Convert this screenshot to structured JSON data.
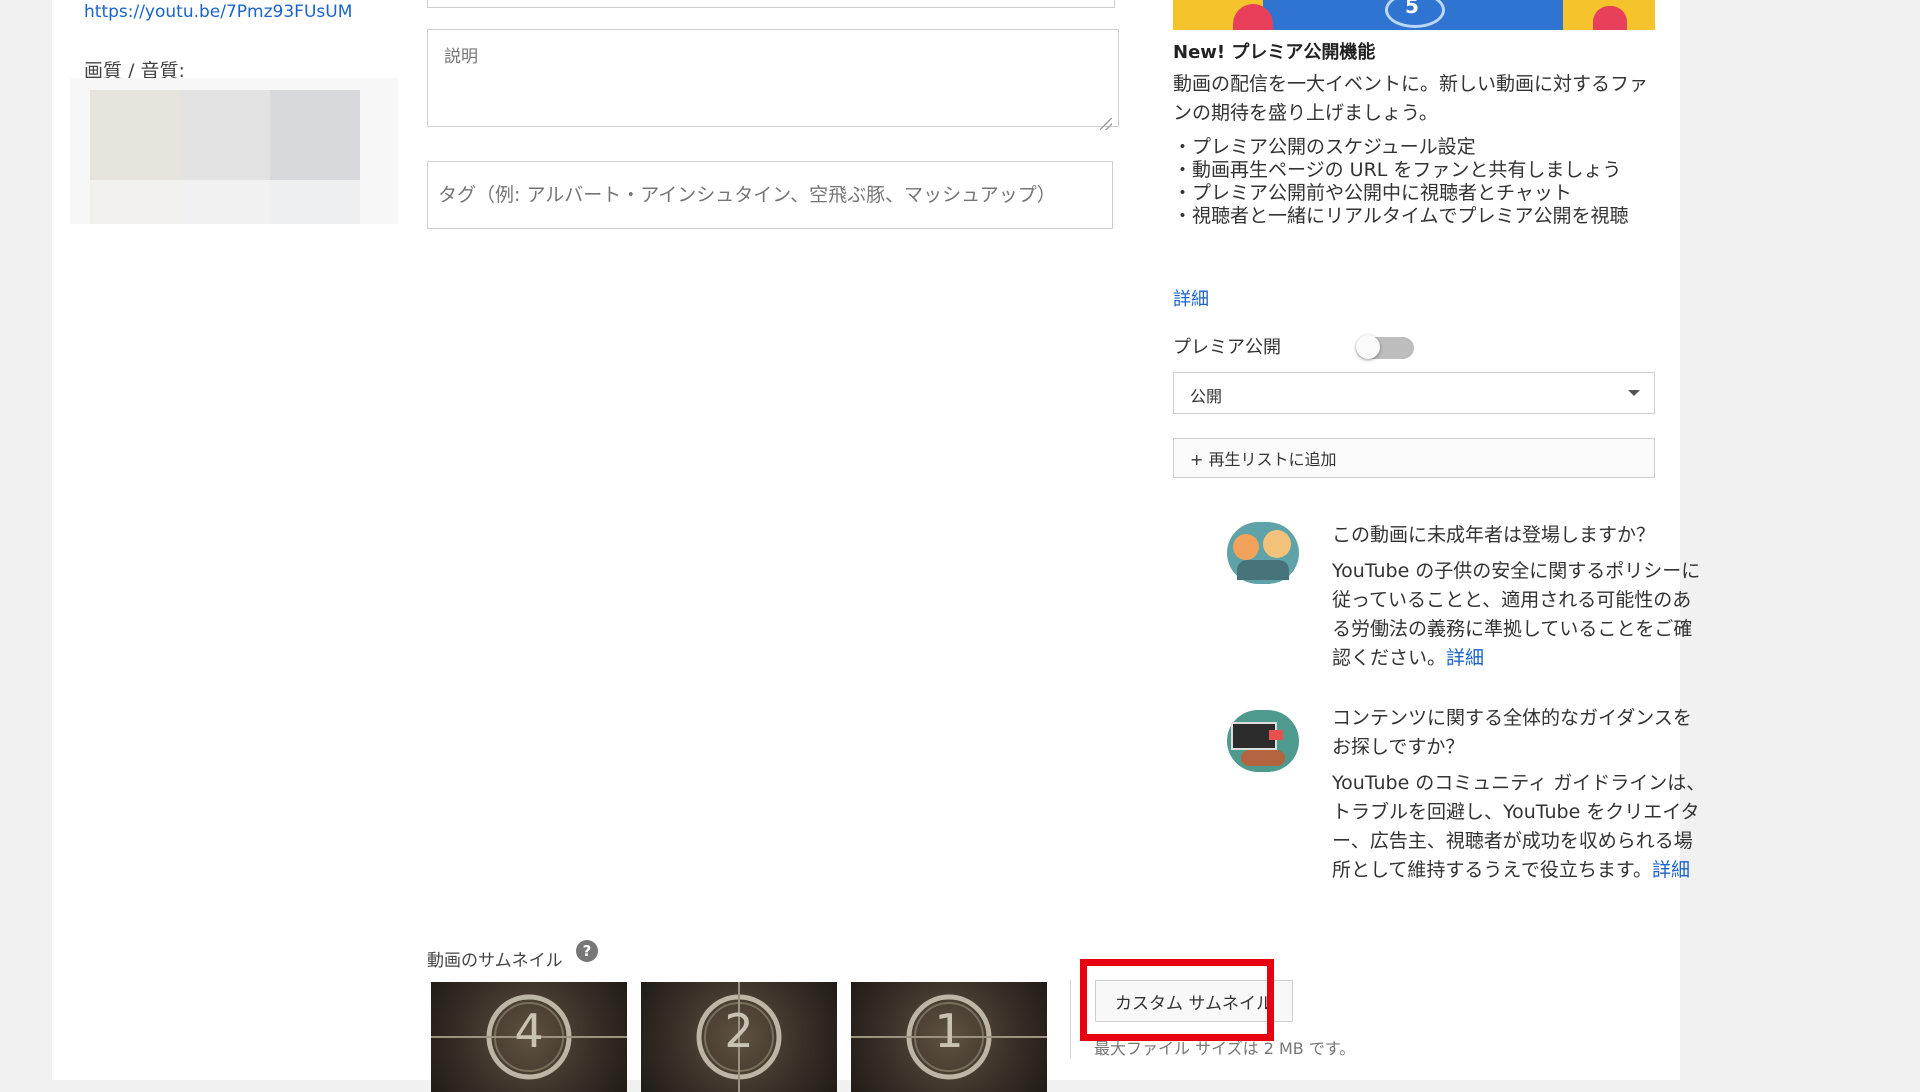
{
  "left": {
    "video_url": "https://youtu.be/7Pmz93FUsUM",
    "quality_label": "画質 / 音質:"
  },
  "form": {
    "description_placeholder": "説明",
    "tags_placeholder": "タグ（例: アルバート・アインシュタイン、空飛ぶ豚、マッシュアップ）"
  },
  "thumbnails": {
    "section_label": "動画のサムネイル",
    "help_icon": "?",
    "items": [
      "4",
      "2",
      "1"
    ],
    "custom_button": "カスタム サムネイル",
    "file_size_note": "最大ファイル サイズは 2 MB です。",
    "highlight_color": "#e60012"
  },
  "premiere": {
    "banner_text": "5",
    "feature_title": "New! プレミア公開機能",
    "feature_desc": "動画の配信を一大イベントに。新しい動画に対するファンの期待を盛り上げましょう。",
    "bullets": [
      "プレミア公開のスケジュール設定",
      "動画再生ページの URL をファンと共有しましょう",
      "プレミア公開前や公開中に視聴者とチャット",
      "視聴者と一緒にリアルタイムでプレミア公開を視聴"
    ],
    "learn_more": "詳細",
    "toggle_label": "プレミア公開",
    "toggle_state": "off"
  },
  "visibility": {
    "selected": "公開"
  },
  "playlist": {
    "add_label": "+ 再生リストに追加"
  },
  "info_cards": [
    {
      "icon": "children-illustration-icon",
      "heading": "この動画に未成年者は登場しますか？",
      "body": "YouTube の子供の安全に関するポリシーに従っていることと、適用される可能性のある労働法の義務に準拠していることをご確認ください。",
      "link": "詳細"
    },
    {
      "icon": "guidelines-illustration-icon",
      "heading": "コンテンツに関する全体的なガイダンスをお探しですか？",
      "body": "YouTube のコミュニティ ガイドラインは、トラブルを回避し、YouTube をクリエイター、広告主、視聴者が成功を収められる場所として維持するうえで役立ちます。",
      "link": "詳細"
    }
  ],
  "colors": {
    "link": "#1a63c9",
    "toggle_off": "#bdbdbd"
  }
}
